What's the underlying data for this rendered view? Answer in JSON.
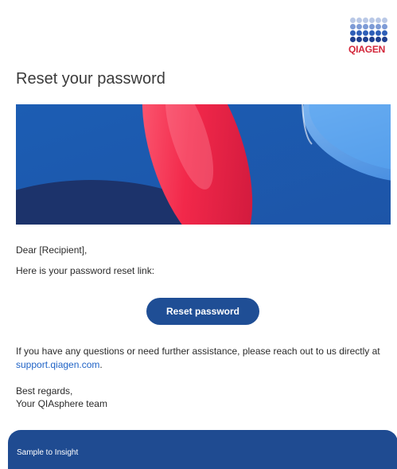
{
  "brand": {
    "logo_text": "QIAGEN",
    "colors": {
      "primary_blue": "#1f4e95",
      "logo_red": "#d3263a",
      "link_blue": "#1f63c6"
    }
  },
  "email": {
    "title": "Reset your password",
    "greeting": "Dear [Recipient],",
    "intro": "Here is your password reset link:",
    "button_label": "Reset password",
    "question_text": "If you have any questions or need further assistance, please reach out to us directly at",
    "support_link": "support.qiagen.com",
    "support_suffix": ".",
    "closing_line1": "Best regards,",
    "closing_line2": "Your QIAsphere team"
  },
  "footer": {
    "tagline": "Sample to Insight"
  }
}
